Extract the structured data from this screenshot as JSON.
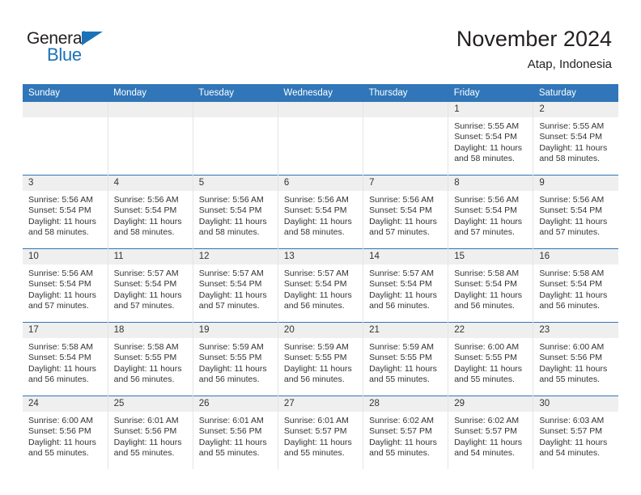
{
  "brand": {
    "name_part1": "General",
    "name_part2": "Blue",
    "accent_color": "#1b72b8"
  },
  "header": {
    "title": "November 2024",
    "subtitle": "Atap, Indonesia"
  },
  "theme": {
    "header_blue": "#3076b8",
    "daynum_band": "#efefef",
    "text": "#333333"
  },
  "weekdays": [
    "Sunday",
    "Monday",
    "Tuesday",
    "Wednesday",
    "Thursday",
    "Friday",
    "Saturday"
  ],
  "labels": {
    "sunrise_prefix": "Sunrise: ",
    "sunset_prefix": "Sunset: ",
    "daylight_prefix": "Daylight: "
  },
  "weeks": [
    [
      {
        "day": "",
        "empty": true
      },
      {
        "day": "",
        "empty": true
      },
      {
        "day": "",
        "empty": true
      },
      {
        "day": "",
        "empty": true
      },
      {
        "day": "",
        "empty": true
      },
      {
        "day": "1",
        "sunrise": "Sunrise: 5:55 AM",
        "sunset": "Sunset: 5:54 PM",
        "daylight": "Daylight: 11 hours and 58 minutes."
      },
      {
        "day": "2",
        "sunrise": "Sunrise: 5:55 AM",
        "sunset": "Sunset: 5:54 PM",
        "daylight": "Daylight: 11 hours and 58 minutes."
      }
    ],
    [
      {
        "day": "3",
        "sunrise": "Sunrise: 5:56 AM",
        "sunset": "Sunset: 5:54 PM",
        "daylight": "Daylight: 11 hours and 58 minutes."
      },
      {
        "day": "4",
        "sunrise": "Sunrise: 5:56 AM",
        "sunset": "Sunset: 5:54 PM",
        "daylight": "Daylight: 11 hours and 58 minutes."
      },
      {
        "day": "5",
        "sunrise": "Sunrise: 5:56 AM",
        "sunset": "Sunset: 5:54 PM",
        "daylight": "Daylight: 11 hours and 58 minutes."
      },
      {
        "day": "6",
        "sunrise": "Sunrise: 5:56 AM",
        "sunset": "Sunset: 5:54 PM",
        "daylight": "Daylight: 11 hours and 58 minutes."
      },
      {
        "day": "7",
        "sunrise": "Sunrise: 5:56 AM",
        "sunset": "Sunset: 5:54 PM",
        "daylight": "Daylight: 11 hours and 57 minutes."
      },
      {
        "day": "8",
        "sunrise": "Sunrise: 5:56 AM",
        "sunset": "Sunset: 5:54 PM",
        "daylight": "Daylight: 11 hours and 57 minutes."
      },
      {
        "day": "9",
        "sunrise": "Sunrise: 5:56 AM",
        "sunset": "Sunset: 5:54 PM",
        "daylight": "Daylight: 11 hours and 57 minutes."
      }
    ],
    [
      {
        "day": "10",
        "sunrise": "Sunrise: 5:56 AM",
        "sunset": "Sunset: 5:54 PM",
        "daylight": "Daylight: 11 hours and 57 minutes."
      },
      {
        "day": "11",
        "sunrise": "Sunrise: 5:57 AM",
        "sunset": "Sunset: 5:54 PM",
        "daylight": "Daylight: 11 hours and 57 minutes."
      },
      {
        "day": "12",
        "sunrise": "Sunrise: 5:57 AM",
        "sunset": "Sunset: 5:54 PM",
        "daylight": "Daylight: 11 hours and 57 minutes."
      },
      {
        "day": "13",
        "sunrise": "Sunrise: 5:57 AM",
        "sunset": "Sunset: 5:54 PM",
        "daylight": "Daylight: 11 hours and 56 minutes."
      },
      {
        "day": "14",
        "sunrise": "Sunrise: 5:57 AM",
        "sunset": "Sunset: 5:54 PM",
        "daylight": "Daylight: 11 hours and 56 minutes."
      },
      {
        "day": "15",
        "sunrise": "Sunrise: 5:58 AM",
        "sunset": "Sunset: 5:54 PM",
        "daylight": "Daylight: 11 hours and 56 minutes."
      },
      {
        "day": "16",
        "sunrise": "Sunrise: 5:58 AM",
        "sunset": "Sunset: 5:54 PM",
        "daylight": "Daylight: 11 hours and 56 minutes."
      }
    ],
    [
      {
        "day": "17",
        "sunrise": "Sunrise: 5:58 AM",
        "sunset": "Sunset: 5:54 PM",
        "daylight": "Daylight: 11 hours and 56 minutes."
      },
      {
        "day": "18",
        "sunrise": "Sunrise: 5:58 AM",
        "sunset": "Sunset: 5:55 PM",
        "daylight": "Daylight: 11 hours and 56 minutes."
      },
      {
        "day": "19",
        "sunrise": "Sunrise: 5:59 AM",
        "sunset": "Sunset: 5:55 PM",
        "daylight": "Daylight: 11 hours and 56 minutes."
      },
      {
        "day": "20",
        "sunrise": "Sunrise: 5:59 AM",
        "sunset": "Sunset: 5:55 PM",
        "daylight": "Daylight: 11 hours and 56 minutes."
      },
      {
        "day": "21",
        "sunrise": "Sunrise: 5:59 AM",
        "sunset": "Sunset: 5:55 PM",
        "daylight": "Daylight: 11 hours and 55 minutes."
      },
      {
        "day": "22",
        "sunrise": "Sunrise: 6:00 AM",
        "sunset": "Sunset: 5:55 PM",
        "daylight": "Daylight: 11 hours and 55 minutes."
      },
      {
        "day": "23",
        "sunrise": "Sunrise: 6:00 AM",
        "sunset": "Sunset: 5:56 PM",
        "daylight": "Daylight: 11 hours and 55 minutes."
      }
    ],
    [
      {
        "day": "24",
        "sunrise": "Sunrise: 6:00 AM",
        "sunset": "Sunset: 5:56 PM",
        "daylight": "Daylight: 11 hours and 55 minutes."
      },
      {
        "day": "25",
        "sunrise": "Sunrise: 6:01 AM",
        "sunset": "Sunset: 5:56 PM",
        "daylight": "Daylight: 11 hours and 55 minutes."
      },
      {
        "day": "26",
        "sunrise": "Sunrise: 6:01 AM",
        "sunset": "Sunset: 5:56 PM",
        "daylight": "Daylight: 11 hours and 55 minutes."
      },
      {
        "day": "27",
        "sunrise": "Sunrise: 6:01 AM",
        "sunset": "Sunset: 5:57 PM",
        "daylight": "Daylight: 11 hours and 55 minutes."
      },
      {
        "day": "28",
        "sunrise": "Sunrise: 6:02 AM",
        "sunset": "Sunset: 5:57 PM",
        "daylight": "Daylight: 11 hours and 55 minutes."
      },
      {
        "day": "29",
        "sunrise": "Sunrise: 6:02 AM",
        "sunset": "Sunset: 5:57 PM",
        "daylight": "Daylight: 11 hours and 54 minutes."
      },
      {
        "day": "30",
        "sunrise": "Sunrise: 6:03 AM",
        "sunset": "Sunset: 5:57 PM",
        "daylight": "Daylight: 11 hours and 54 minutes."
      }
    ]
  ]
}
